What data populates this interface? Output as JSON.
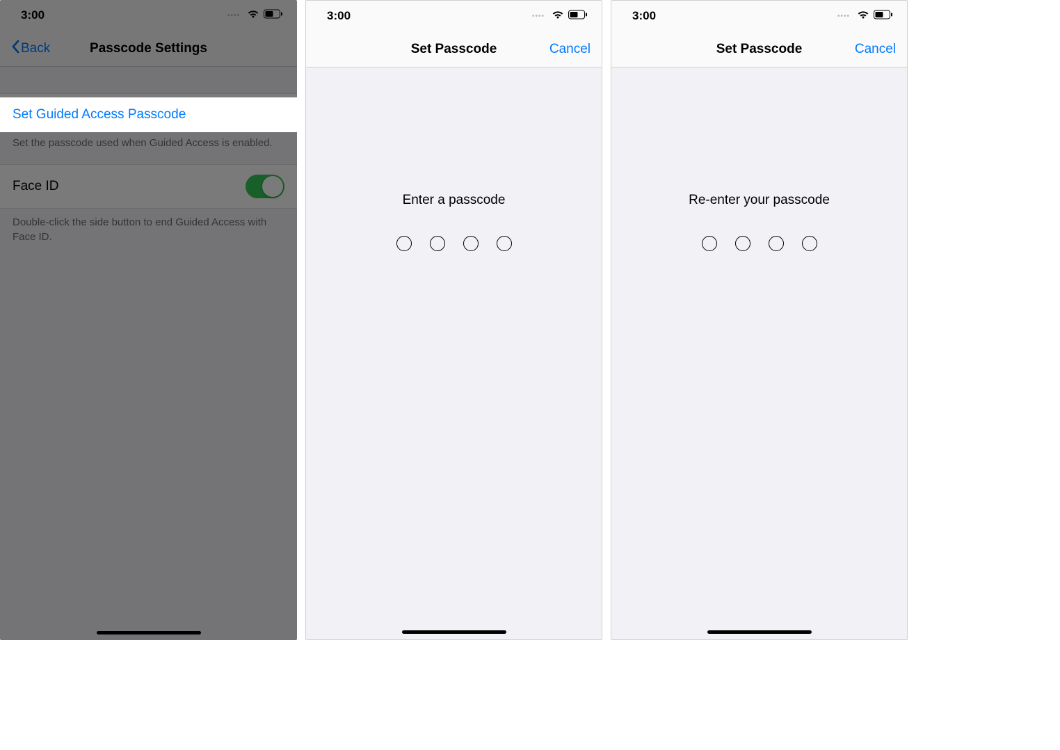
{
  "status": {
    "time": "3:00"
  },
  "screen1": {
    "back_label": "Back",
    "title": "Passcode Settings",
    "set_passcode_label": "Set Guided Access Passcode",
    "set_passcode_footer": "Set the passcode used when Guided Access is enabled.",
    "faceid_label": "Face ID",
    "faceid_footer": "Double-click the side button to end Guided Access with Face ID."
  },
  "screen2": {
    "title": "Set Passcode",
    "cancel_label": "Cancel",
    "prompt": "Enter a passcode"
  },
  "screen3": {
    "title": "Set Passcode",
    "cancel_label": "Cancel",
    "prompt": "Re-enter your passcode"
  }
}
